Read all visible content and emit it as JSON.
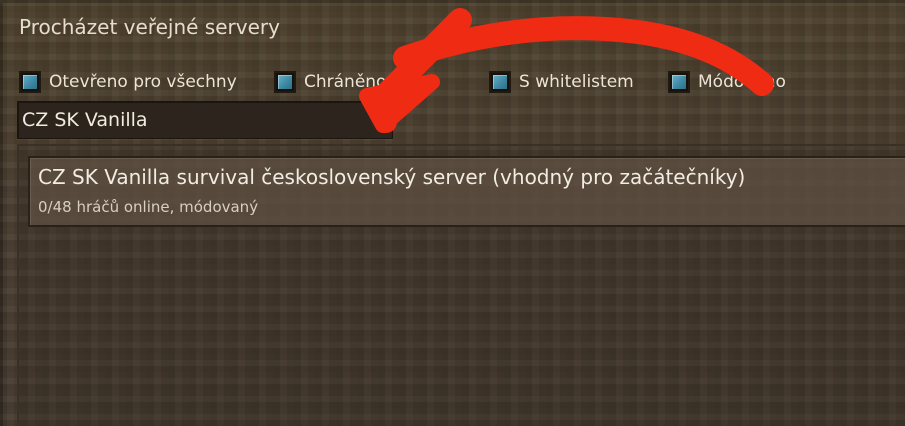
{
  "window": {
    "title": "Procházet veřejné servery"
  },
  "filters": [
    {
      "label": "Otevřeno pro všechny",
      "checked": true
    },
    {
      "label": "Chráněno h",
      "checked": true
    },
    {
      "label": "S whitelistem",
      "checked": true
    },
    {
      "label": "Módováno",
      "checked": true
    }
  ],
  "search": {
    "value": "CZ SK Vanilla"
  },
  "servers": [
    {
      "name": "CZ SK Vanilla survival československý server (vhodný pro začátečníky)",
      "info": "0/48 hráčů online, módovaný"
    }
  ],
  "colors": {
    "checkbox_fill": "#4a98b5",
    "annotation_arrow": "#ef2b14",
    "background": "#4c4031"
  },
  "icons": {
    "annotation": "red-curved-arrow-icon"
  }
}
